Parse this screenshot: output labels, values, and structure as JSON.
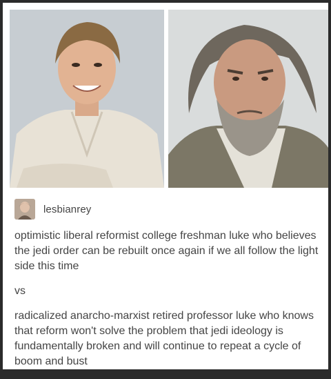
{
  "images": {
    "left": {
      "icon": "young-luke-photo"
    },
    "right": {
      "icon": "old-luke-photo"
    }
  },
  "post": {
    "username": "lesbianrey",
    "paragraph_1": "optimistic liberal reformist college freshman luke who believes the jedi order can be rebuilt once again if we all follow the light side this time",
    "separator": "vs",
    "paragraph_2": "radicalized anarcho-marxist retired professor luke who knows that reform won't solve the problem that jedi ideology is fundamentally broken and will continue to repeat a cycle of boom and bust"
  },
  "colors": {
    "text": "#444444",
    "frame": "#2b2b2b",
    "card": "#ffffff"
  }
}
